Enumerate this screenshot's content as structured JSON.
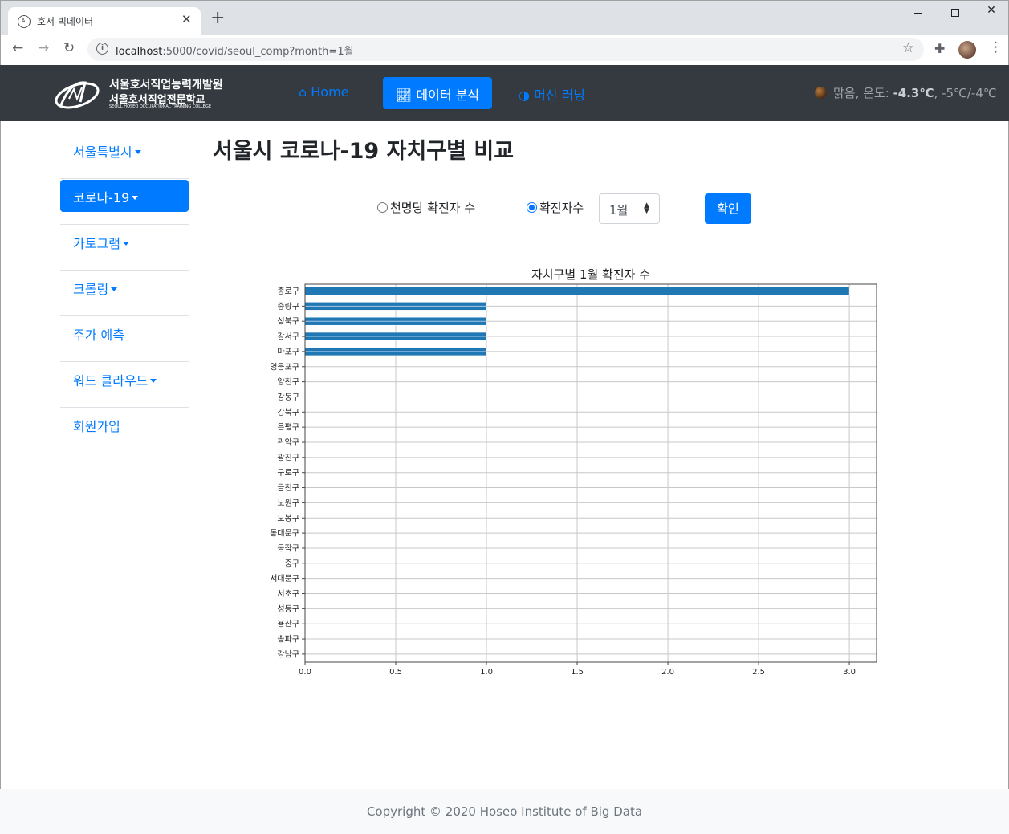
{
  "browser": {
    "tab_title": "호서 빅데이터",
    "tab_close": "✕",
    "new_tab": "+",
    "url_host": "localhost",
    "url_rest": ":5000/covid/seoul_comp?month=1월"
  },
  "navbar": {
    "logo_line1": "서울호서직업능력개발원",
    "logo_line2": "서울호서직업전문학교",
    "logo_line3": "SEOUL HOSEO OCCUPATIONAL TRAINING COLLEGE",
    "home": "Home",
    "data_analysis": "데이터 분석",
    "machine_learning": "머신 러닝",
    "weather_prefix": "맑음, 온도: ",
    "weather_temp": "-4.3℃",
    "weather_range": ", -5℃/-4℃"
  },
  "sidebar": {
    "items": [
      {
        "label": "서울특별시",
        "dropdown": true
      },
      {
        "label": "코로나-19",
        "dropdown": true,
        "active": true
      },
      {
        "label": "카토그램",
        "dropdown": true
      },
      {
        "label": "크롤링",
        "dropdown": true
      },
      {
        "label": "주가 예측",
        "dropdown": false
      },
      {
        "label": "워드 클라우드",
        "dropdown": true
      },
      {
        "label": "회원가입",
        "dropdown": false
      }
    ]
  },
  "main": {
    "title": "서울시 코로나-19 자치구별 비교",
    "radio_per1000": "천명당 확진자 수",
    "radio_count": "확진자수",
    "month_value": "1월",
    "confirm": "확인"
  },
  "chart_data": {
    "type": "bar",
    "orientation": "horizontal",
    "title": "자치구별 1월 확진자 수",
    "categories": [
      "종로구",
      "중랑구",
      "성북구",
      "강서구",
      "마포구",
      "영등포구",
      "양천구",
      "강동구",
      "강북구",
      "은평구",
      "관악구",
      "광진구",
      "구로구",
      "금천구",
      "노원구",
      "도봉구",
      "동대문구",
      "동작구",
      "중구",
      "서대문구",
      "서초구",
      "성동구",
      "용산구",
      "송파구",
      "강남구"
    ],
    "values": [
      3,
      1,
      1,
      1,
      1,
      0,
      0,
      0,
      0,
      0,
      0,
      0,
      0,
      0,
      0,
      0,
      0,
      0,
      0,
      0,
      0,
      0,
      0,
      0,
      0
    ],
    "xlim": [
      0,
      3.15
    ],
    "xticks": [
      "0.0",
      "0.5",
      "1.0",
      "1.5",
      "2.0",
      "2.5",
      "3.0"
    ],
    "grid": true,
    "bar_color": "#1f77b4"
  },
  "footer": {
    "copyright": "Copyright © 2020 Hoseo Institute of Big Data"
  }
}
